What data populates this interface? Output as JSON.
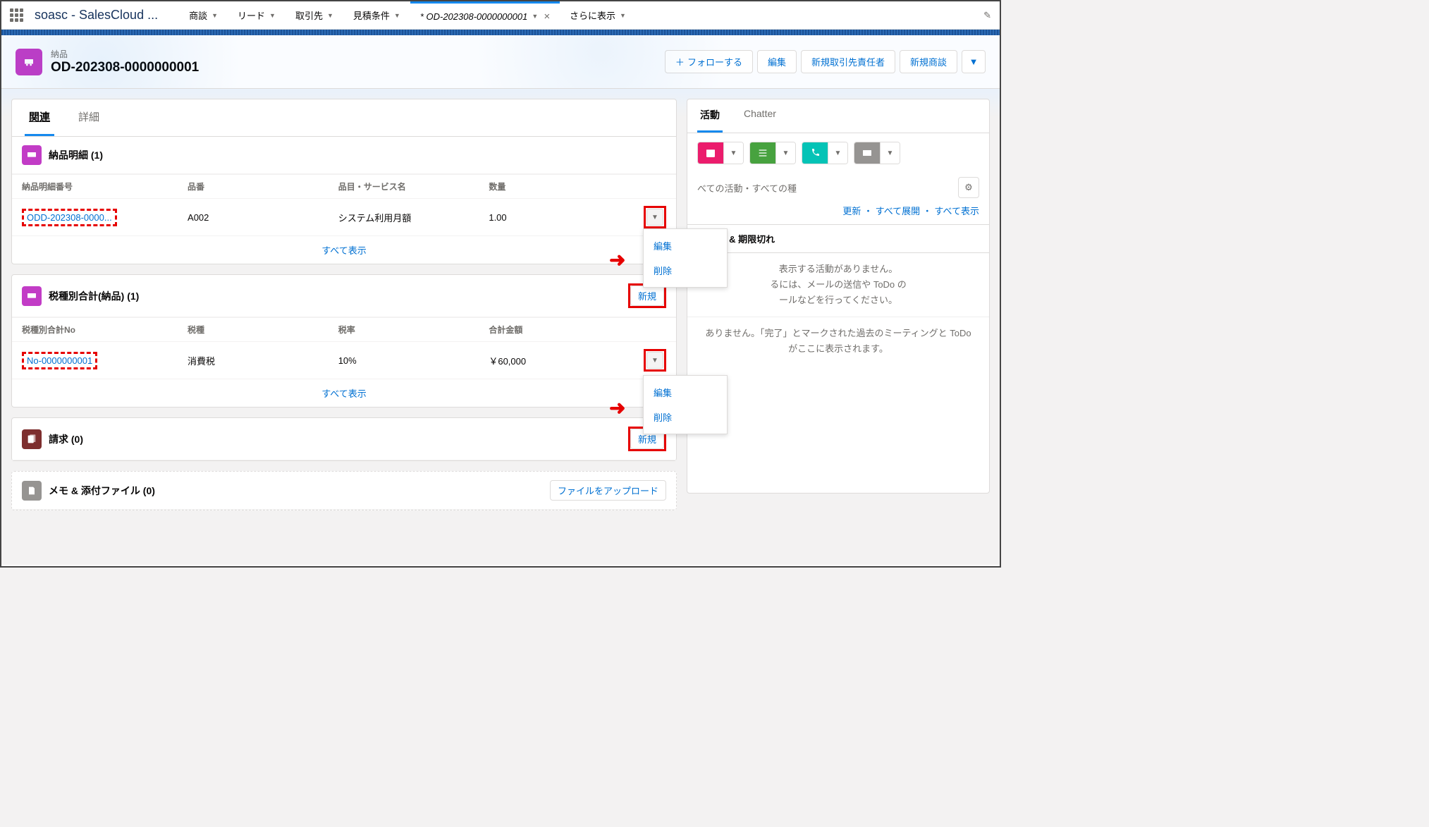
{
  "app_name": "soasc - SalesCloud ...",
  "nav": {
    "items": [
      {
        "label": "商談",
        "dd": true
      },
      {
        "label": "リード",
        "dd": true
      },
      {
        "label": "取引先",
        "dd": true
      },
      {
        "label": "見積条件",
        "dd": true
      }
    ],
    "active_tab": "* OD-202308-0000000001",
    "more": "さらに表示"
  },
  "record": {
    "object_label": "納品",
    "name": "OD-202308-0000000001",
    "actions": {
      "follow": "フォローする",
      "edit": "編集",
      "new_contact": "新規取引先責任者",
      "new_opp": "新規商談"
    }
  },
  "main_tabs": {
    "related": "関連",
    "detail": "詳細"
  },
  "related": {
    "delivery_detail": {
      "title": "納品明細 (1)",
      "cols": [
        "納品明細番号",
        "品番",
        "品目・サービス名",
        "数量"
      ],
      "row": {
        "no": "ODD-202308-0000...",
        "code": "A002",
        "item": "システム利用月額",
        "qty": "1.00"
      },
      "all": "すべて表示"
    },
    "tax_total": {
      "title": "税種別合計(納品) (1)",
      "new": "新規",
      "cols": [
        "税種別合計No",
        "税種",
        "税率",
        "合計金額"
      ],
      "row": {
        "no": "No-0000000001",
        "type": "消費税",
        "rate": "10%",
        "amount": "￥60,000"
      },
      "all": "すべて表示"
    },
    "invoice": {
      "title": "請求 (0)",
      "new": "新規"
    },
    "files": {
      "title": "メモ & 添付ファイル (0)",
      "upload": "ファイルをアップロード"
    }
  },
  "right": {
    "tabs": {
      "activity": "活動",
      "chatter": "Chatter"
    },
    "filter_text": "べての活動・すべての種",
    "sub_links": {
      "refresh": "更新",
      "expand": "すべて展開",
      "showall": "すべて表示"
    },
    "upcoming": "今後 & 期限切れ",
    "empty1": "表示する活動がありません。",
    "empty2": "るには、メールの送信や ToDo の",
    "empty3": "ールなどを行ってください。",
    "past1": "ありません。「完了」とマークされた過去のミーティングと ToDo がここに表示されます。"
  },
  "popup": {
    "edit": "編集",
    "delete": "削除"
  }
}
